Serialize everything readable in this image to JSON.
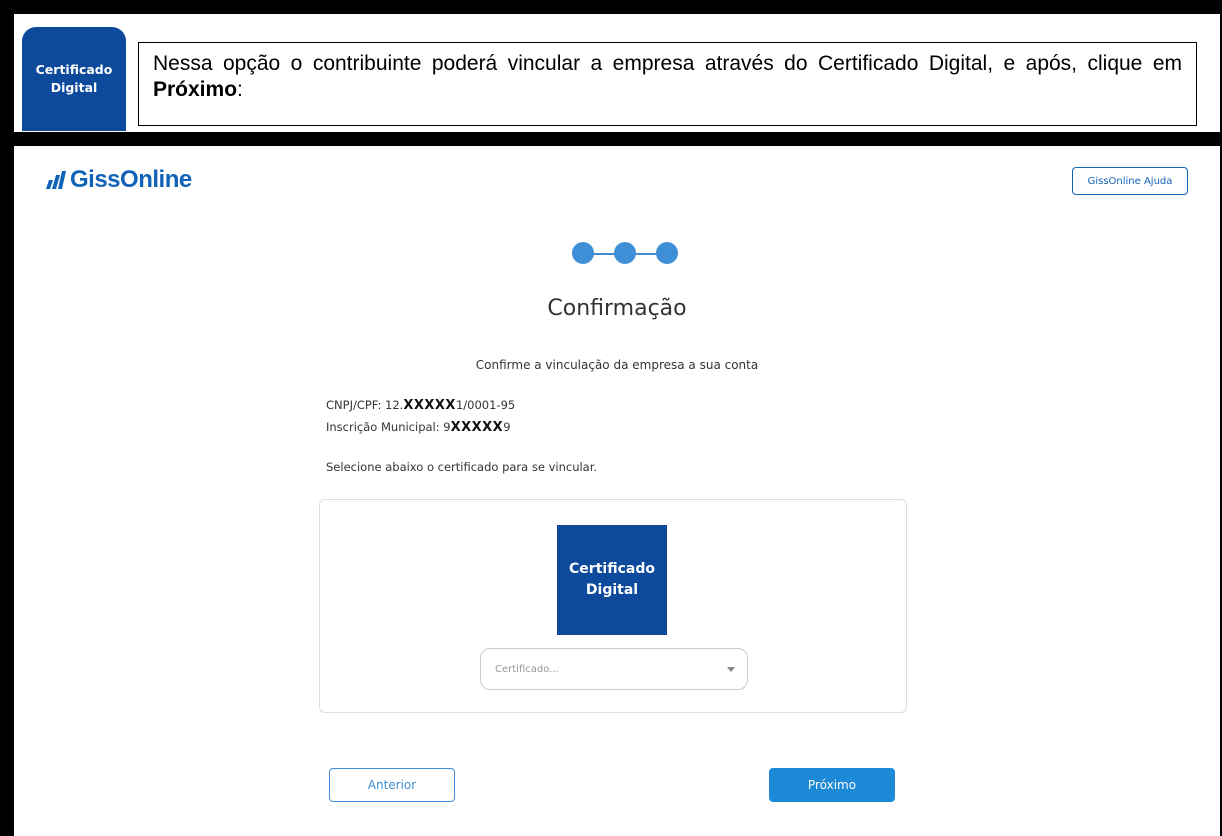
{
  "annotation": {
    "badge_line1": "Certificado",
    "badge_line2": "Digital",
    "callout_part1": "Nessa opção o contribuinte poderá vincular a empresa através do Certificado Digital, e após, clique em ",
    "callout_bold": "Próximo",
    "callout_part2": ":"
  },
  "app": {
    "logo_text": "GissOnline",
    "help_button": "GissOnline Ajuda"
  },
  "wizard": {
    "steps_total": 3,
    "steps_completed": 3,
    "title": "Confirmação",
    "subtitle": "Confirme a vinculação da empresa a sua conta",
    "cnpj_label": "CNPJ/CPF: 12.",
    "cnpj_mask": "XXXXX",
    "cnpj_suffix": "1/0001-95",
    "im_label": "Inscrição Municipal: 9",
    "im_mask": "XXXXX",
    "im_suffix": "9",
    "instruction": "Selecione abaixo o certificado para se vincular.",
    "cert_logo_line1": "Certificado",
    "cert_logo_line2": "Digital",
    "select_placeholder": "Certificado...",
    "prev_button": "Anterior",
    "next_button": "Próximo"
  },
  "colors": {
    "brand_blue": "#1163b8",
    "badge_blue": "#0d4a9c",
    "step_blue": "#3f8fd6",
    "primary_button": "#1c8ad6"
  }
}
